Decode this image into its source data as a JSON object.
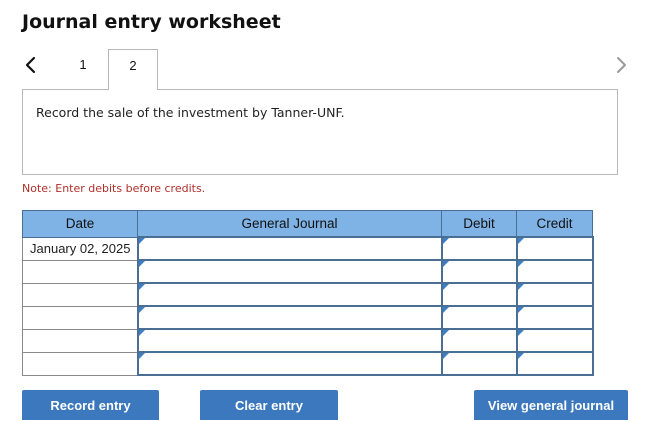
{
  "header": {
    "title": "Journal entry worksheet"
  },
  "tabs": [
    {
      "label": "1",
      "active": false
    },
    {
      "label": "2",
      "active": true
    }
  ],
  "nav": {
    "prev_icon": "chevron-left-icon",
    "next_icon": "chevron-right-icon"
  },
  "instruction": "Record the sale of the investment by Tanner-UNF.",
  "note": "Note: Enter debits before credits.",
  "table": {
    "headers": {
      "date": "Date",
      "general_journal": "General Journal",
      "debit": "Debit",
      "credit": "Credit"
    },
    "rows": [
      {
        "date": "January 02, 2025",
        "account": "",
        "debit": "",
        "credit": ""
      },
      {
        "date": "",
        "account": "",
        "debit": "",
        "credit": ""
      },
      {
        "date": "",
        "account": "",
        "debit": "",
        "credit": ""
      },
      {
        "date": "",
        "account": "",
        "debit": "",
        "credit": ""
      },
      {
        "date": "",
        "account": "",
        "debit": "",
        "credit": ""
      },
      {
        "date": "",
        "account": "",
        "debit": "",
        "credit": ""
      }
    ]
  },
  "buttons": {
    "record": "Record entry",
    "clear": "Clear entry",
    "view": "View general journal"
  },
  "colors": {
    "header_bg": "#7fb2e5",
    "button_bg": "#3b78be",
    "note_text": "#b0302a"
  }
}
